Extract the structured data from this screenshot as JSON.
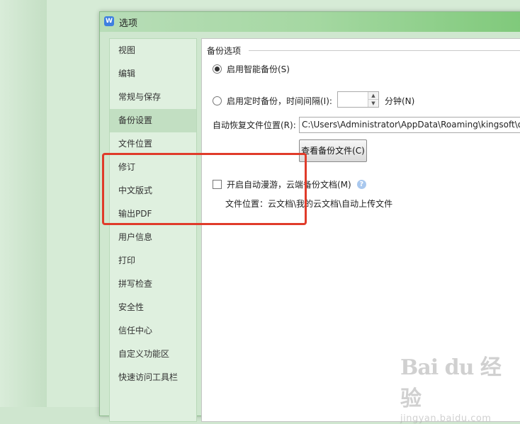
{
  "window": {
    "title": "选项",
    "app_icon": "W"
  },
  "sidebar": {
    "items": [
      {
        "label": "视图"
      },
      {
        "label": "编辑"
      },
      {
        "label": "常规与保存"
      },
      {
        "label": "备份设置",
        "active": true
      },
      {
        "label": "文件位置"
      },
      {
        "label": "修订"
      },
      {
        "label": "中文版式"
      },
      {
        "label": "输出PDF"
      },
      {
        "label": "用户信息"
      },
      {
        "label": "打印"
      },
      {
        "label": "拼写检查"
      },
      {
        "label": "安全性"
      },
      {
        "label": "信任中心"
      },
      {
        "label": "自定义功能区"
      },
      {
        "label": "快速访问工具栏"
      }
    ]
  },
  "backup": {
    "group_title": "备份选项",
    "smart_backup_label": "启用智能备份(S)",
    "smart_backup_selected": true,
    "timed_backup_label": "启用定时备份，时间间隔(I):",
    "timed_backup_selected": false,
    "interval_value": "",
    "interval_unit": "分钟(N)",
    "recovery_path_label": "自动恢复文件位置(R):",
    "recovery_path_value": "C:\\Users\\Administrator\\AppData\\Roaming\\kingsoft\\office",
    "view_backup_button": "查看备份文件(C)"
  },
  "cloud": {
    "roaming_label": "开启自动漫游，云端备份文档(M)",
    "roaming_checked": false,
    "location_text": "文件位置：云文档\\我的云文档\\自动上传文件"
  },
  "watermark": {
    "logo": "Bai du 经验",
    "site": "jingyan.baidu.com"
  },
  "colors": {
    "highlight_border": "#e03b2a",
    "active_nav": "#c2dfc2",
    "titlebar_accent": "#7fc97a"
  }
}
